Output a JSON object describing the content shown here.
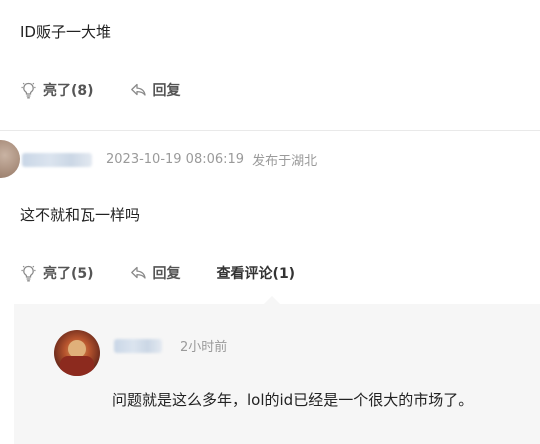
{
  "comment1": {
    "text": "ID贩子一大堆",
    "like_label": "亮了(8)",
    "reply_label": "回复"
  },
  "comment2": {
    "timestamp": "2023-10-19 08:06:19",
    "location": "发布于湖北",
    "text": "这不就和瓦一样吗",
    "like_label": "亮了(5)",
    "reply_label": "回复",
    "view_replies_label": "查看评论(1)"
  },
  "reply": {
    "time_ago": "2小时前",
    "text": "问题就是这么多年，lol的id已经是一个很大的市场了。"
  },
  "icons": {
    "like": "lightbulb-icon",
    "reply": "reply-arrow-icon"
  },
  "colors": {
    "text": "#222222",
    "meta": "#9a9a9a",
    "reply_bg": "#f6f6f6"
  }
}
